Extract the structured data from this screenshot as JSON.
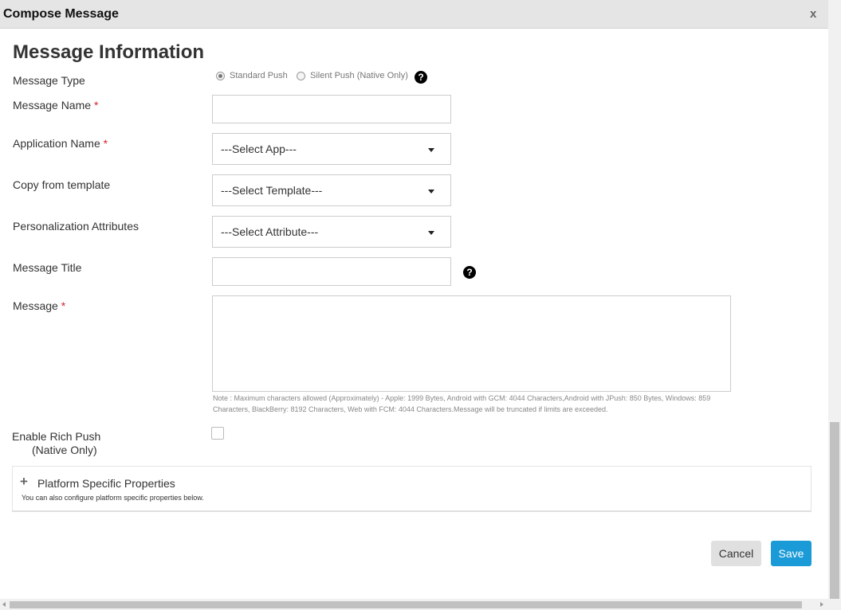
{
  "window": {
    "title": "Compose Message",
    "close_label": "x"
  },
  "form": {
    "heading": "Message Information",
    "required_marker": "*",
    "message_type": {
      "label": "Message Type",
      "options": [
        "Standard Push",
        "Silent Push (Native Only)"
      ],
      "selected": "Standard Push",
      "help_icon": "?"
    },
    "message_name": {
      "label": "Message Name",
      "value": ""
    },
    "application_name": {
      "label": "Application Name",
      "selected": "---Select App---"
    },
    "copy_template": {
      "label": "Copy from template",
      "selected": "---Select Template---"
    },
    "personalization": {
      "label": "Personalization Attributes",
      "selected": "---Select Attribute---"
    },
    "message_title": {
      "label": "Message Title",
      "value": "",
      "help_icon": "?"
    },
    "message": {
      "label": "Message",
      "value": "",
      "note": "Note : Maximum characters allowed (Approximately) - Apple: 1999 Bytes, Android with GCM: 4044 Characters,Android with JPush: 850 Bytes, Windows: 859 Characters, BlackBerry: 8192 Characters, Web with FCM: 4044 Characters.Message will be truncated if limits are exceeded."
    },
    "rich_push": {
      "label_line1": "Enable Rich Push",
      "label_line2": "(Native Only)",
      "checked": false
    },
    "platform_panel": {
      "icon": "+",
      "title": "Platform Specific Properties",
      "subtitle": "You can also configure platform specific properties below."
    }
  },
  "actions": {
    "cancel_label": "Cancel",
    "save_label": "Save"
  },
  "colors": {
    "save_button": "#1a9ad6",
    "required": "#d9232e",
    "titlebar": "#e5e5e5"
  }
}
